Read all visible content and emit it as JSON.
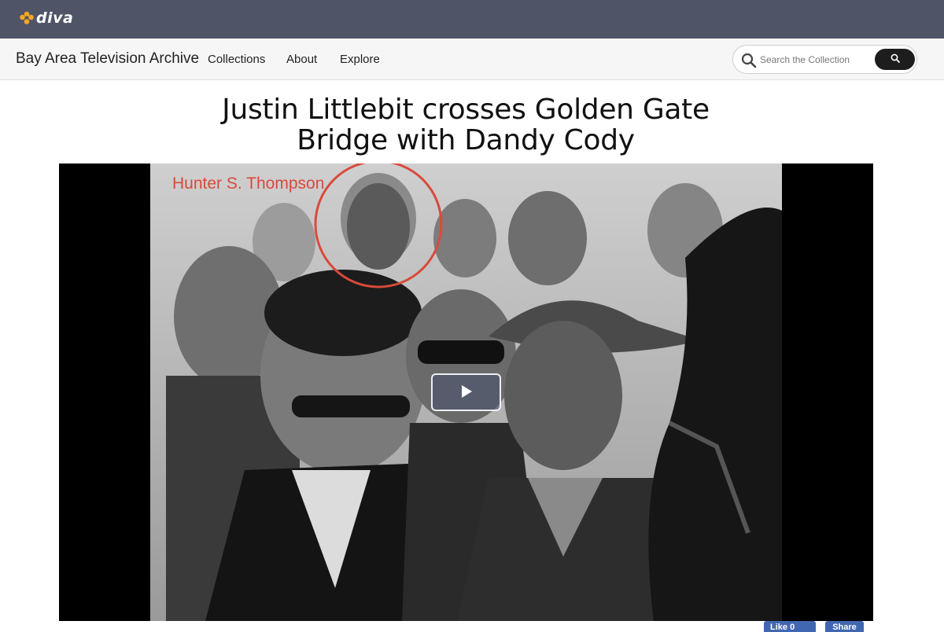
{
  "brand": {
    "logo_text": "diva",
    "logo_icon": "flower-icon",
    "accent_color": "#f5a623"
  },
  "nav": {
    "site_title": "Bay Area Television Archive",
    "links": [
      "Collections",
      "About",
      "Explore"
    ]
  },
  "search": {
    "placeholder": "Search the Collection",
    "value": ""
  },
  "page": {
    "title": "Justin Littlebit crosses Golden Gate Bridge with Dandy Cody"
  },
  "video": {
    "caption_label": "Hunter S. Thompson",
    "highlight_color": "#d94a3a",
    "play_icon": "play-icon"
  },
  "social": {
    "like_label": "Like 0",
    "share_label": "Share"
  }
}
